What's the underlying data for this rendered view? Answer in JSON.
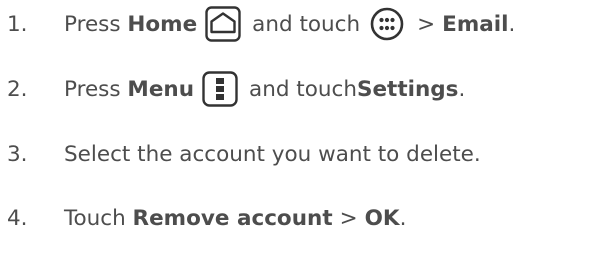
{
  "steps": [
    {
      "number": "1.",
      "parts": {
        "t1": "Press ",
        "b1": "Home",
        "icon1": "home-key-icon",
        "t2": "and touch",
        "icon2": "apps-icon",
        "t3": ">",
        "b2": "Email",
        "t4": "."
      }
    },
    {
      "number": "2.",
      "parts": {
        "t1": "Press ",
        "b1": "Menu",
        "icon1": "menu-key-icon",
        "t2": "and touch ",
        "b2": "Settings",
        "t3": "."
      }
    },
    {
      "number": "3.",
      "parts": {
        "t1": "Select the account you want to delete."
      }
    },
    {
      "number": "4.",
      "parts": {
        "t1": "Touch ",
        "b1": "Remove account",
        "t2": ">",
        "b2": "OK",
        "t3": "."
      }
    }
  ],
  "colors": {
    "text": "#4d4d4d",
    "icon": "#333333"
  }
}
